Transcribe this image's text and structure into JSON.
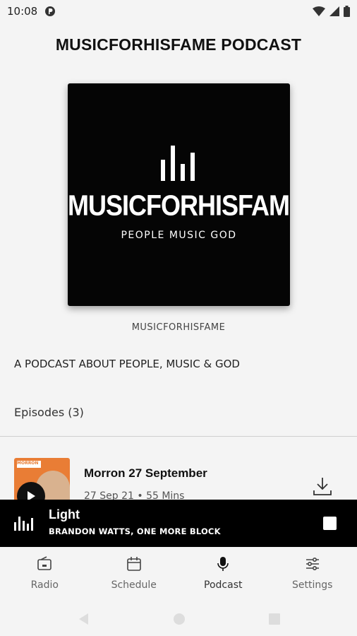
{
  "status_bar": {
    "time": "10:08"
  },
  "header": {
    "title": "MUSICFORHISFAME PODCAST"
  },
  "podcast": {
    "artwork_brand": "MUSICFORHISFAME",
    "artwork_tagline": "PEOPLE MUSIC GOD",
    "author": "MUSICFORHISFAME",
    "description": "A PODCAST ABOUT PEOPLE, MUSIC & GOD",
    "episodes_heading": "Episodes (3)"
  },
  "episodes": [
    {
      "title": "Morron 27 September",
      "meta": "27 Sep 21 • 55 Mins",
      "thumb_label": "MORRON"
    }
  ],
  "mini_player": {
    "title": "Light",
    "artist": "BRANDON WATTS, ONE MORE BLOCK"
  },
  "bottom_nav": [
    {
      "label": "Radio",
      "icon": "radio-icon"
    },
    {
      "label": "Schedule",
      "icon": "calendar-icon"
    },
    {
      "label": "Podcast",
      "icon": "microphone-icon",
      "active": true
    },
    {
      "label": "Settings",
      "icon": "sliders-icon"
    }
  ],
  "colors": {
    "accent": "#000000",
    "background": "#f4f4f4",
    "episode_thumb": "#e97d35"
  }
}
